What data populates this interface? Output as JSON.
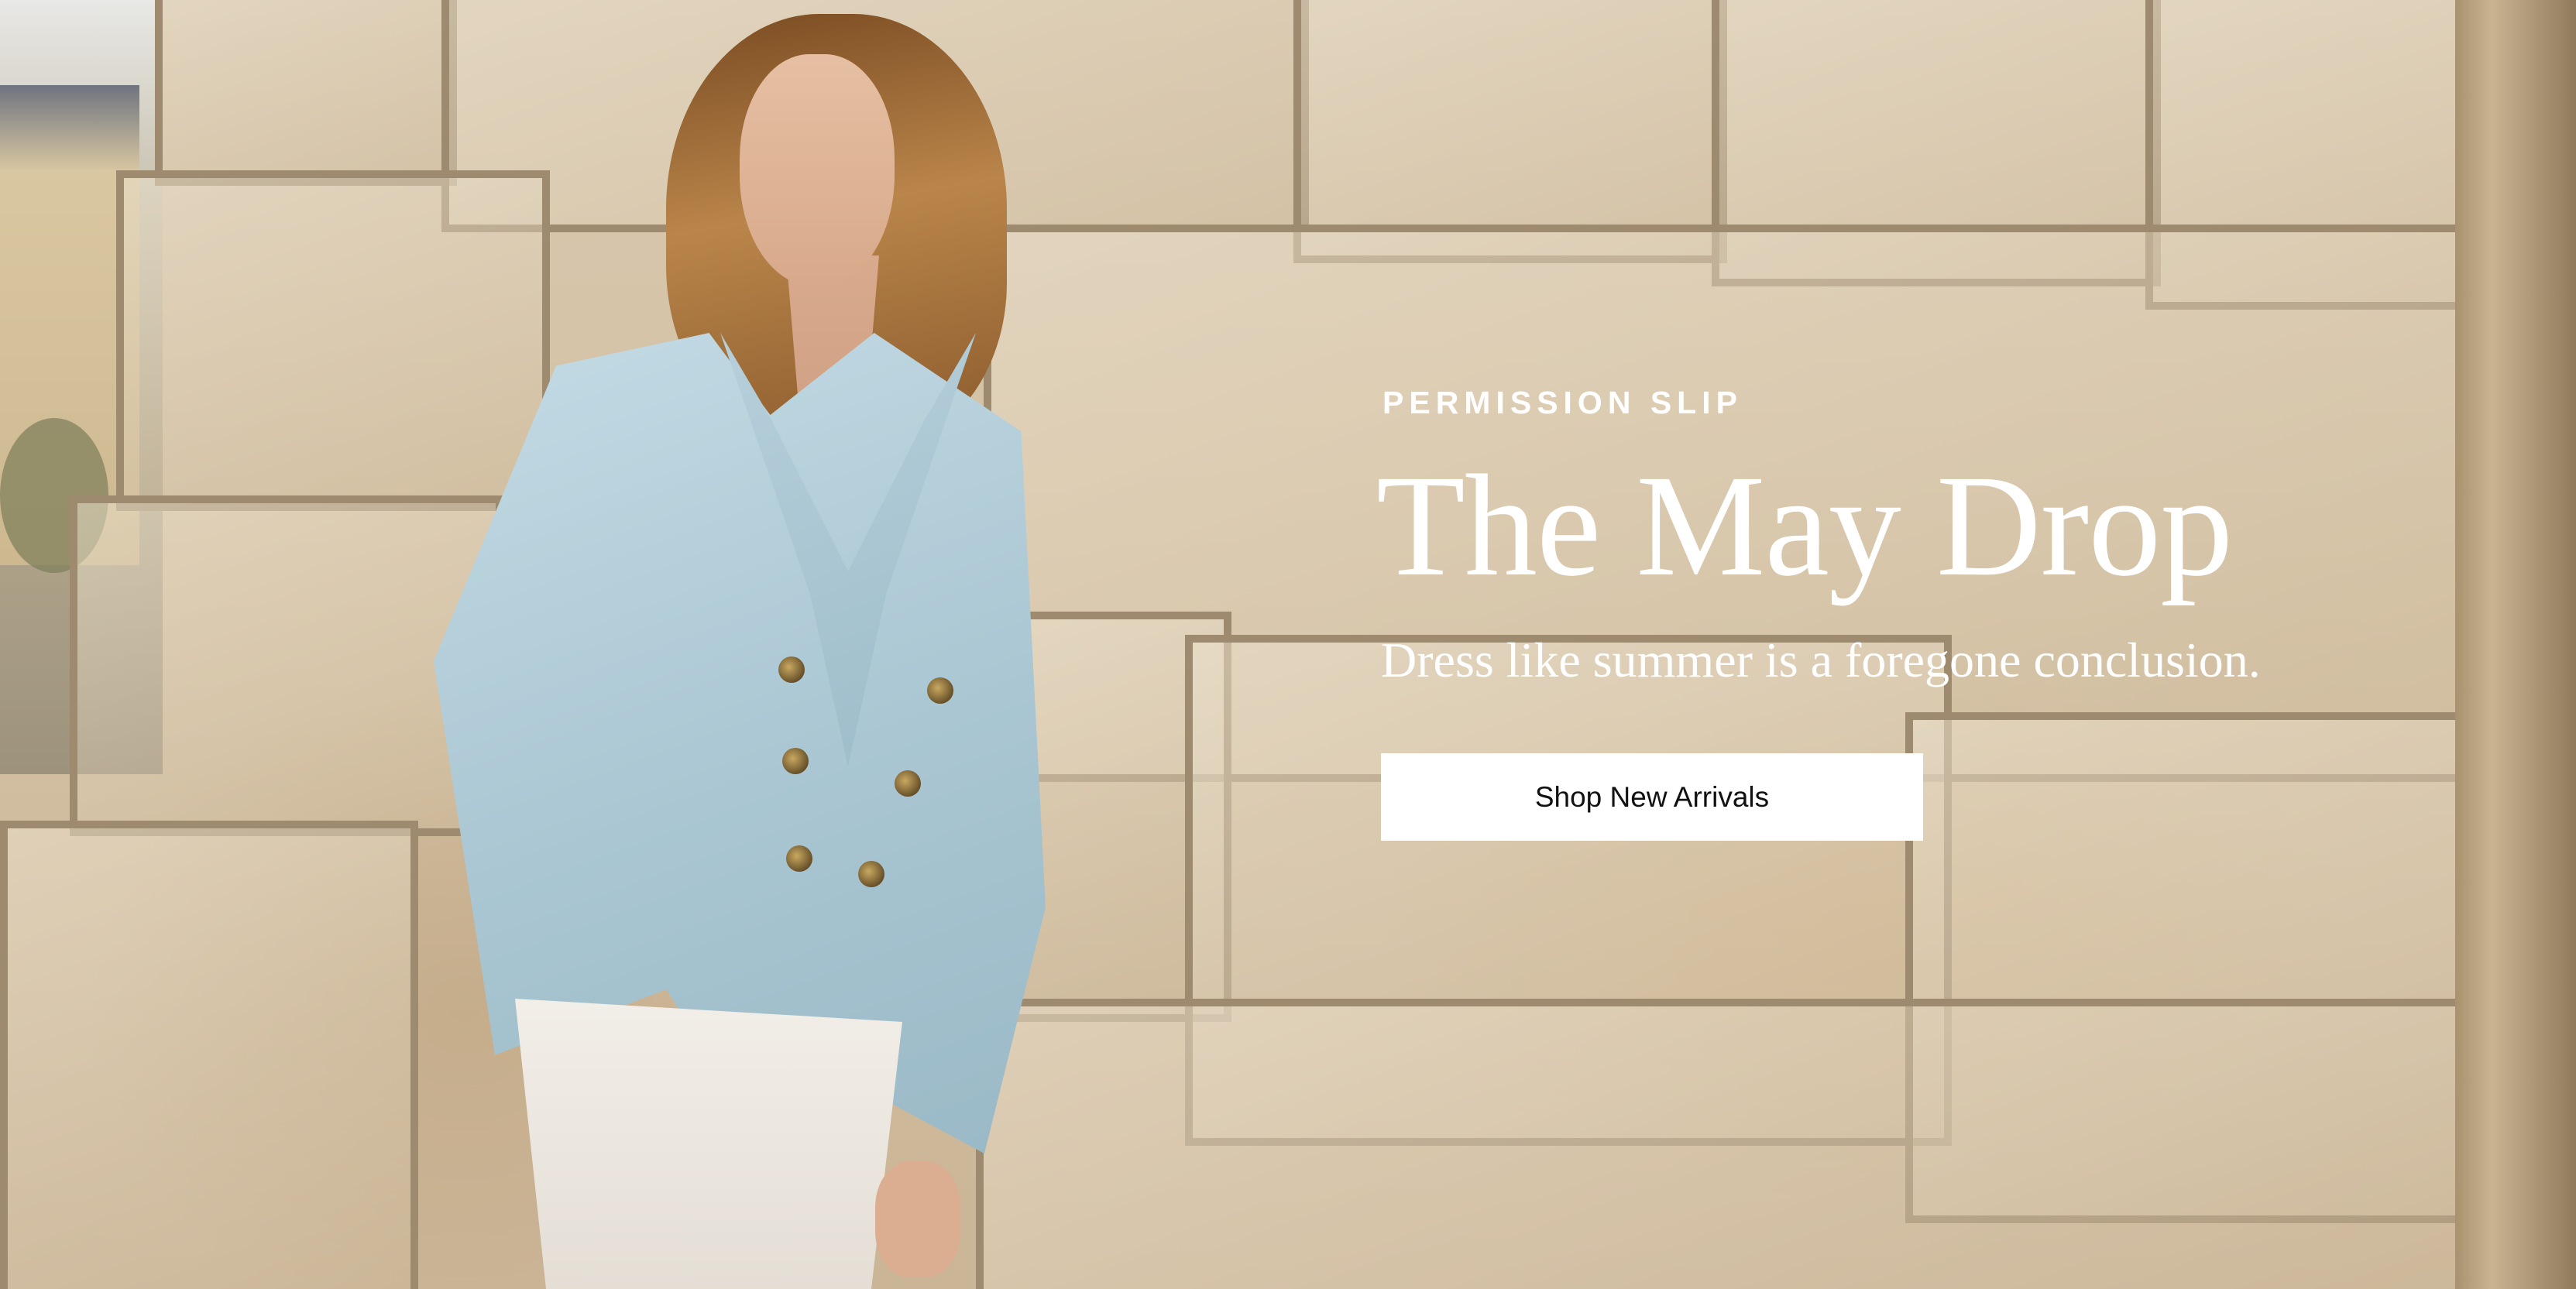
{
  "hero": {
    "eyebrow": "PERMISSION SLIP",
    "headline": "The May Drop",
    "subheadline": "Dress like summer is a foregone conclusion.",
    "cta_label": "Shop New Arrivals"
  },
  "colors": {
    "text": "#ffffff",
    "cta_background": "#ffffff",
    "cta_text": "#111111",
    "jacket": "#b4cfdb",
    "stone": "#d3c0a2"
  }
}
